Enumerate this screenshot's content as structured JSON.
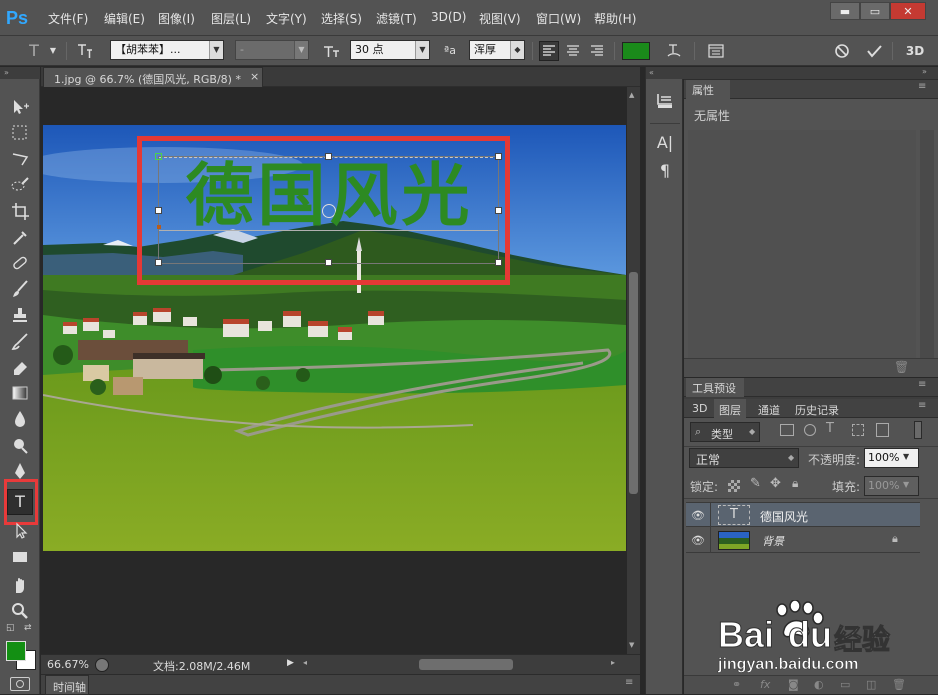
{
  "app": {
    "logo": "Ps"
  },
  "menu": [
    "文件(F)",
    "编辑(E)",
    "图像(I)",
    "图层(L)",
    "文字(Y)",
    "选择(S)",
    "滤镜(T)",
    "3D(D)",
    "视图(V)",
    "窗口(W)",
    "帮助(H)"
  ],
  "window_controls": {
    "minimize": "▬",
    "maximize": "▭",
    "close": "✕"
  },
  "options": {
    "tool_icon": "T",
    "font_family": "【胡苯苯】...",
    "font_style": "-",
    "font_size": "30 点",
    "aa_label": "ªa",
    "antialias": "浑厚",
    "text_color": "#1a8a1a",
    "three_d": "3D"
  },
  "document": {
    "tab_title": "1.jpg @ 66.7% (德国风光, RGB/8) *",
    "tab_close": "×",
    "overlay_text": "德国风光",
    "overlay_color": "#2d8a22",
    "highlight_color": "#e53935"
  },
  "status": {
    "zoom": "66.67%",
    "doc_info": "文档:2.08M/2.46M"
  },
  "timeline_tab": "时间轴",
  "properties": {
    "title": "属性",
    "content": "无属性"
  },
  "tool_presets": {
    "title": "工具预设"
  },
  "layers_panel": {
    "tabs": [
      "3D",
      "图层",
      "通道",
      "历史记录"
    ],
    "active_tab": "图层",
    "filter_kind": "类型",
    "blend_mode": "正常",
    "opacity_label": "不透明度:",
    "opacity_value": "100%",
    "lock_label": "锁定:",
    "fill_label": "填充:",
    "fill_value": "100%",
    "layers": [
      {
        "name": "德国风光",
        "type": "text",
        "thumb": "T",
        "selected": true
      },
      {
        "name": "背景",
        "type": "image",
        "selected": false
      }
    ]
  },
  "watermark": {
    "brand": "Bai",
    "brand2": "du",
    "cn": "经验",
    "url": "jingyan.baidu.com"
  }
}
